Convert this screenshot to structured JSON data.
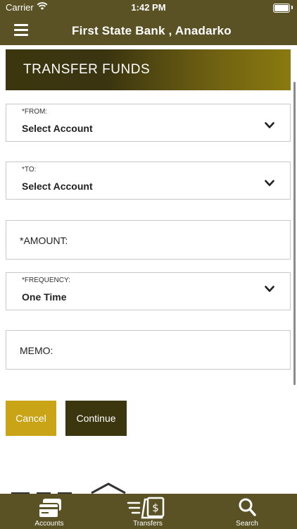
{
  "status_bar": {
    "carrier": "Carrier",
    "time": "1:42 PM"
  },
  "nav": {
    "title": "First State Bank , Anadarko",
    "menu_icon": "hamburger-menu-icon"
  },
  "page": {
    "title": "TRANSFER FUNDS"
  },
  "form": {
    "from": {
      "label": "*FROM:",
      "value": "Select Account"
    },
    "to": {
      "label": "*TO:",
      "value": "Select Account"
    },
    "amount": {
      "label": "*AMOUNT:"
    },
    "frequency": {
      "label": "*FREQUENCY:",
      "value": "One Time"
    },
    "memo": {
      "label": "MEMO:"
    }
  },
  "buttons": {
    "cancel": "Cancel",
    "continue": "Continue"
  },
  "tabs": [
    {
      "label": "Accounts",
      "icon": "card-icon"
    },
    {
      "label": "Transfers",
      "icon": "transfer-dollar-icon"
    },
    {
      "label": "Search",
      "icon": "search-icon"
    }
  ],
  "colors": {
    "brand_olive": "#5a5224",
    "cancel_gold": "#c9a417",
    "continue_dark": "#3c360f"
  }
}
